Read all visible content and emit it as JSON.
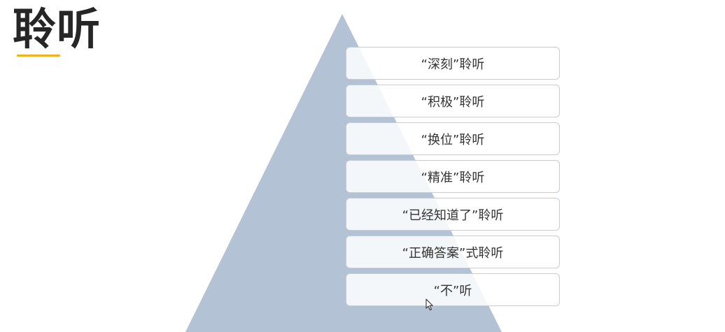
{
  "slide": {
    "title": "聆听",
    "accent_color": "#f0b21e",
    "pyramid_color": "#b3c2d4",
    "levels": [
      {
        "label": "“深刻”聆听"
      },
      {
        "label": "“积极”聆听"
      },
      {
        "label": "“换位”聆听"
      },
      {
        "label": "“精准”聆听"
      },
      {
        "label": "“已经知道了”聆听"
      },
      {
        "label": "“正确答案”式聆听"
      },
      {
        "label": "“不”听"
      }
    ]
  },
  "cursor": {
    "icon": "mouse-pointer-icon"
  }
}
